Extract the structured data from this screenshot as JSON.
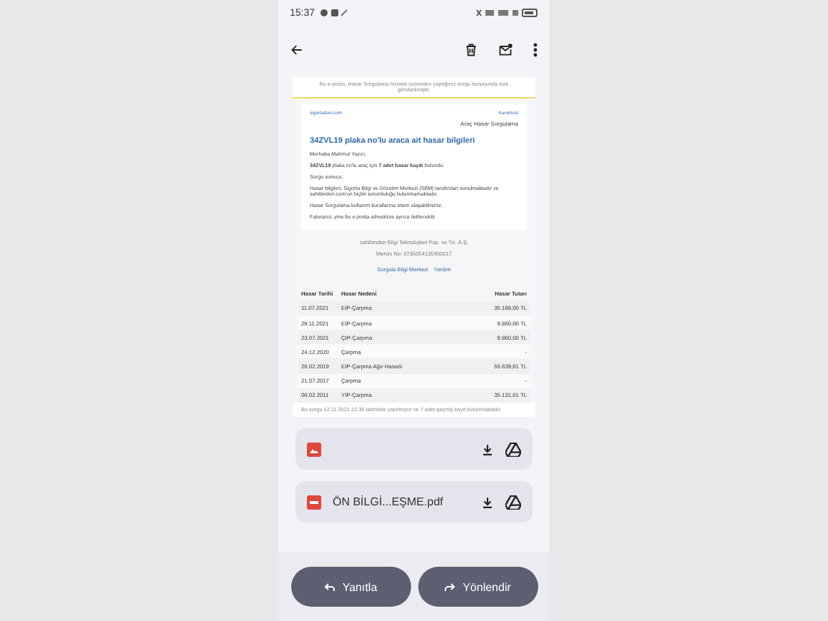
{
  "status_bar": {
    "time": "15:37"
  },
  "email": {
    "preheader": "Bu e-posta, Hasar Sorgulama hizmeti üzerinden yaptığınız sorgu sonucunda size gönderilmiştir.",
    "logo_text": "sigortadan.com",
    "logo_right": "Kurumsal",
    "service": "Araç Hasar Sorgulama",
    "heading": "34ZVL19 plaka no'lu araca ait hasar bilgileri",
    "paragraphs": [
      "Merhaba Mahmut Yazıcı,",
      "**34ZVL19** plaka no'lu araç için **7 adet hasar kaydı** bulundu.",
      "Sorgu sonucu;",
      "Hasar bilgileri, Sigorta Bilgi ve Gözetim Merkezi (SBM) tarafından sunulmaktadır ve sahibinden.com'un hiçbir sorumluluğu bulunmamaktadır.",
      "Hasar Sorgulama kullanım kurallarına sitem ulaşabilirsiniz.",
      "Faturanız, yine bu e-posta adresinize ayrıca iletilecektir."
    ],
    "footer": [
      "sahibinden Bilgi Teknolojileri Paz. ve Tic. A.Ş.",
      "Mersis No: 0735054135900017"
    ],
    "footer_links": [
      "Sorgula Bilgi Merkezi",
      "Yardım"
    ],
    "table": {
      "columns": [
        "Hasar Tarihi",
        "Hasar Nedeni",
        "Hasar Tutarı"
      ],
      "rows": [
        [
          "11.07.2021",
          "EIP-Çarpma",
          "35.168,00 TL"
        ],
        [
          "29.11.2021",
          "EIP-Çarpma",
          "9.860,00 TL"
        ],
        [
          "23.07.2021",
          "ÇIP-Çarpma",
          "9.860,00 TL"
        ],
        [
          "24.12.2020",
          "Çarpma",
          "-"
        ],
        [
          "26.02.2019",
          "EIP-Çarpma Ağır Hasarlı",
          "55.639,61 TL"
        ],
        [
          "21.07.2017",
          "Çarpma",
          "-"
        ],
        [
          "06.02.2011",
          "YIP-Çarpma",
          "35.131,61 TL"
        ]
      ]
    },
    "note": "Bu sorgu 12.11.2021 22:36 tarihinde yapılmıştır ve 7 adet geçmiş kayıt bulunmaktadır."
  },
  "attachments": [
    {
      "kind": "image"
    },
    {
      "kind": "pdf",
      "name": "ÖN BİLGİ...EŞME.pdf"
    }
  ],
  "actions": [
    "Yanıtla",
    "Yönlendir"
  ]
}
